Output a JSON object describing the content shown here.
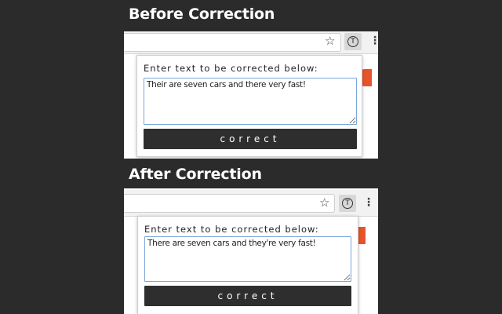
{
  "before": {
    "heading": "Before Correction",
    "popup_label": "Enter text to be corrected below:",
    "input_text": "Their are seven cars and there very fast!",
    "button_label": "correct"
  },
  "after": {
    "heading": "After Correction",
    "popup_label": "Enter text to be corrected below:",
    "input_text": "There are seven cars and they're very fast!",
    "button_label": "correct"
  },
  "toolbar": {
    "star_icon": "star-icon",
    "extension_icon": "T",
    "menu_icon": "⋮"
  },
  "colors": {
    "background": "#2b2b2b",
    "accent_orange": "#e8542a",
    "button_dark": "#2e2e2e",
    "textarea_border": "#7aa7d8"
  }
}
